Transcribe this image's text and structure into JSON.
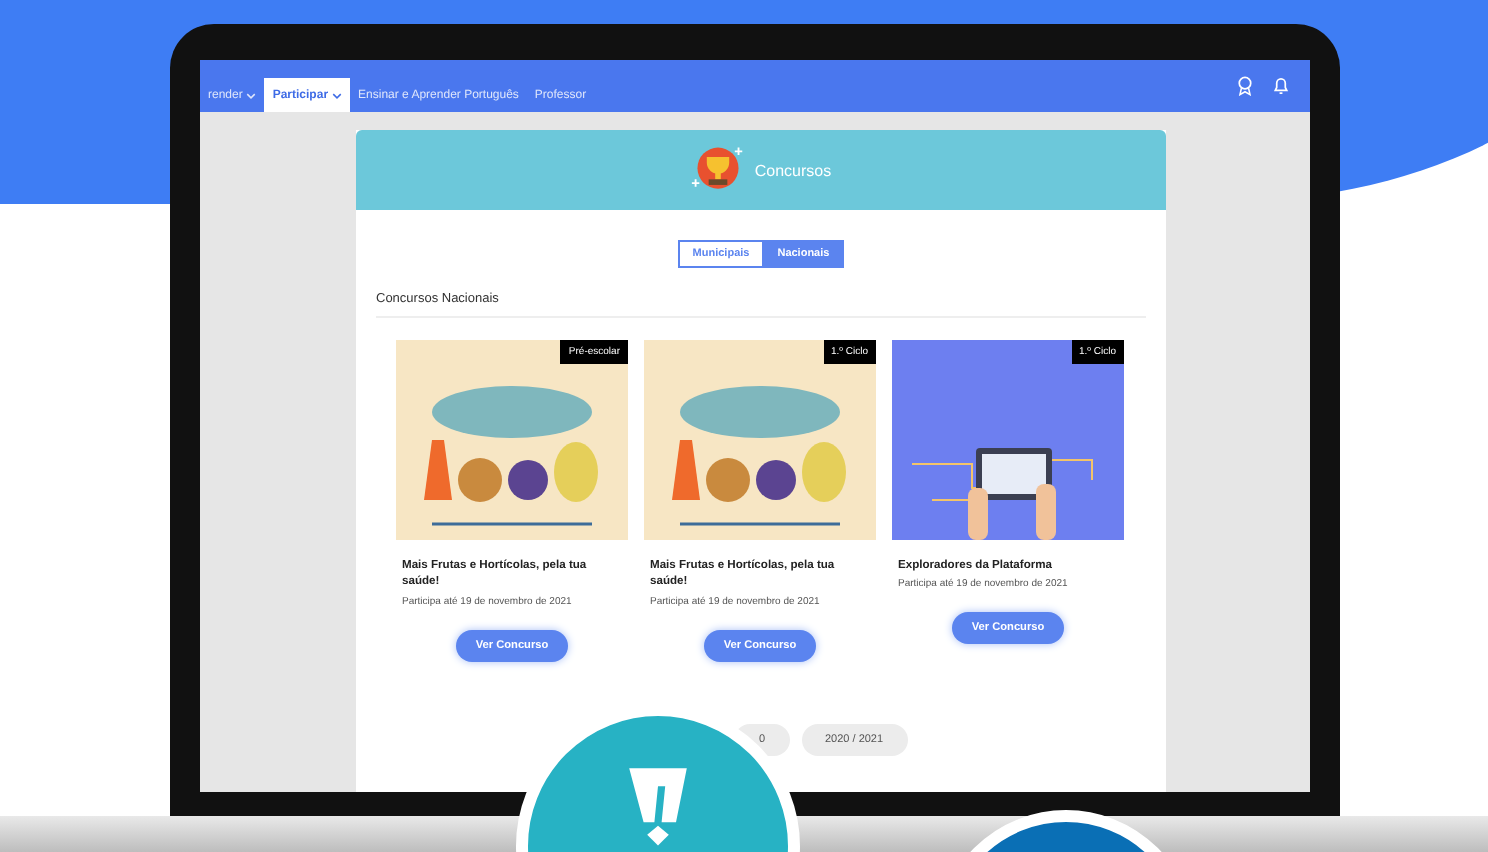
{
  "nav": {
    "items": [
      {
        "label": "render",
        "selected": false,
        "dropdown": true
      },
      {
        "label": "Participar",
        "selected": true,
        "dropdown": true
      },
      {
        "label": "Ensinar e Aprender Português",
        "selected": false,
        "dropdown": false
      },
      {
        "label": "Professor",
        "selected": false,
        "dropdown": false
      }
    ]
  },
  "header": {
    "title": "Concursos"
  },
  "scope_tabs": [
    {
      "label": "Municipais",
      "selected": false
    },
    {
      "label": "Nacionais",
      "selected": true
    }
  ],
  "section_title": "Concursos Nacionais",
  "cards": [
    {
      "kind": "fruits",
      "tag": "Pré-escolar",
      "title": "Mais Frutas e Hortícolas, pela tua saúde!",
      "deadline": "Participa até 19 de novembro de 2021",
      "button": "Ver Concurso"
    },
    {
      "kind": "fruits",
      "tag": "1.º Ciclo",
      "title": "Mais Frutas e Hortícolas, pela tua saúde!",
      "deadline": "Participa até 19 de novembro de 2021",
      "button": "Ver Concurso"
    },
    {
      "kind": "platform",
      "tag": "1.º Ciclo",
      "title": "Exploradores da Plataforma",
      "deadline": "Participa até 19 de novembro de 2021",
      "button": "Ver Concurso"
    }
  ],
  "years": [
    {
      "label": "0"
    },
    {
      "label": "2020 / 2021"
    }
  ]
}
